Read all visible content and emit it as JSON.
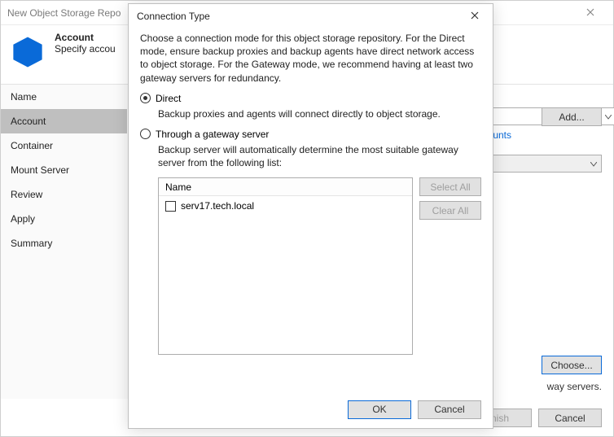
{
  "outer": {
    "title": "New Object Storage Repo",
    "header_title": "Account",
    "header_subtitle": "Specify accou",
    "nav": [
      "Name",
      "Account",
      "Container",
      "Mount Server",
      "Review",
      "Apply",
      "Summary"
    ],
    "nav_selected_index": 1,
    "add_btn": "Add...",
    "link": "accounts",
    "choose_btn": "Choose...",
    "gw_text": "way servers.",
    "footer": {
      "finish": "nish",
      "cancel": "Cancel"
    }
  },
  "modal": {
    "title": "Connection Type",
    "description": "Choose a connection mode for this object storage repository. For the Direct mode, ensure backup proxies and backup agents have direct network access to object storage. For the Gateway mode, we recommend having at least two gateway servers for redundancy.",
    "direct": {
      "label": "Direct",
      "desc": "Backup proxies and agents will connect directly to object storage.",
      "selected": true
    },
    "gateway": {
      "label": "Through a gateway server",
      "desc": "Backup server will automatically determine the most suitable gateway server from the following list:",
      "selected": false
    },
    "list": {
      "header": "Name",
      "items": [
        "serv17.tech.local"
      ]
    },
    "buttons": {
      "select_all": "Select All",
      "clear_all": "Clear All",
      "ok": "OK",
      "cancel": "Cancel"
    }
  }
}
